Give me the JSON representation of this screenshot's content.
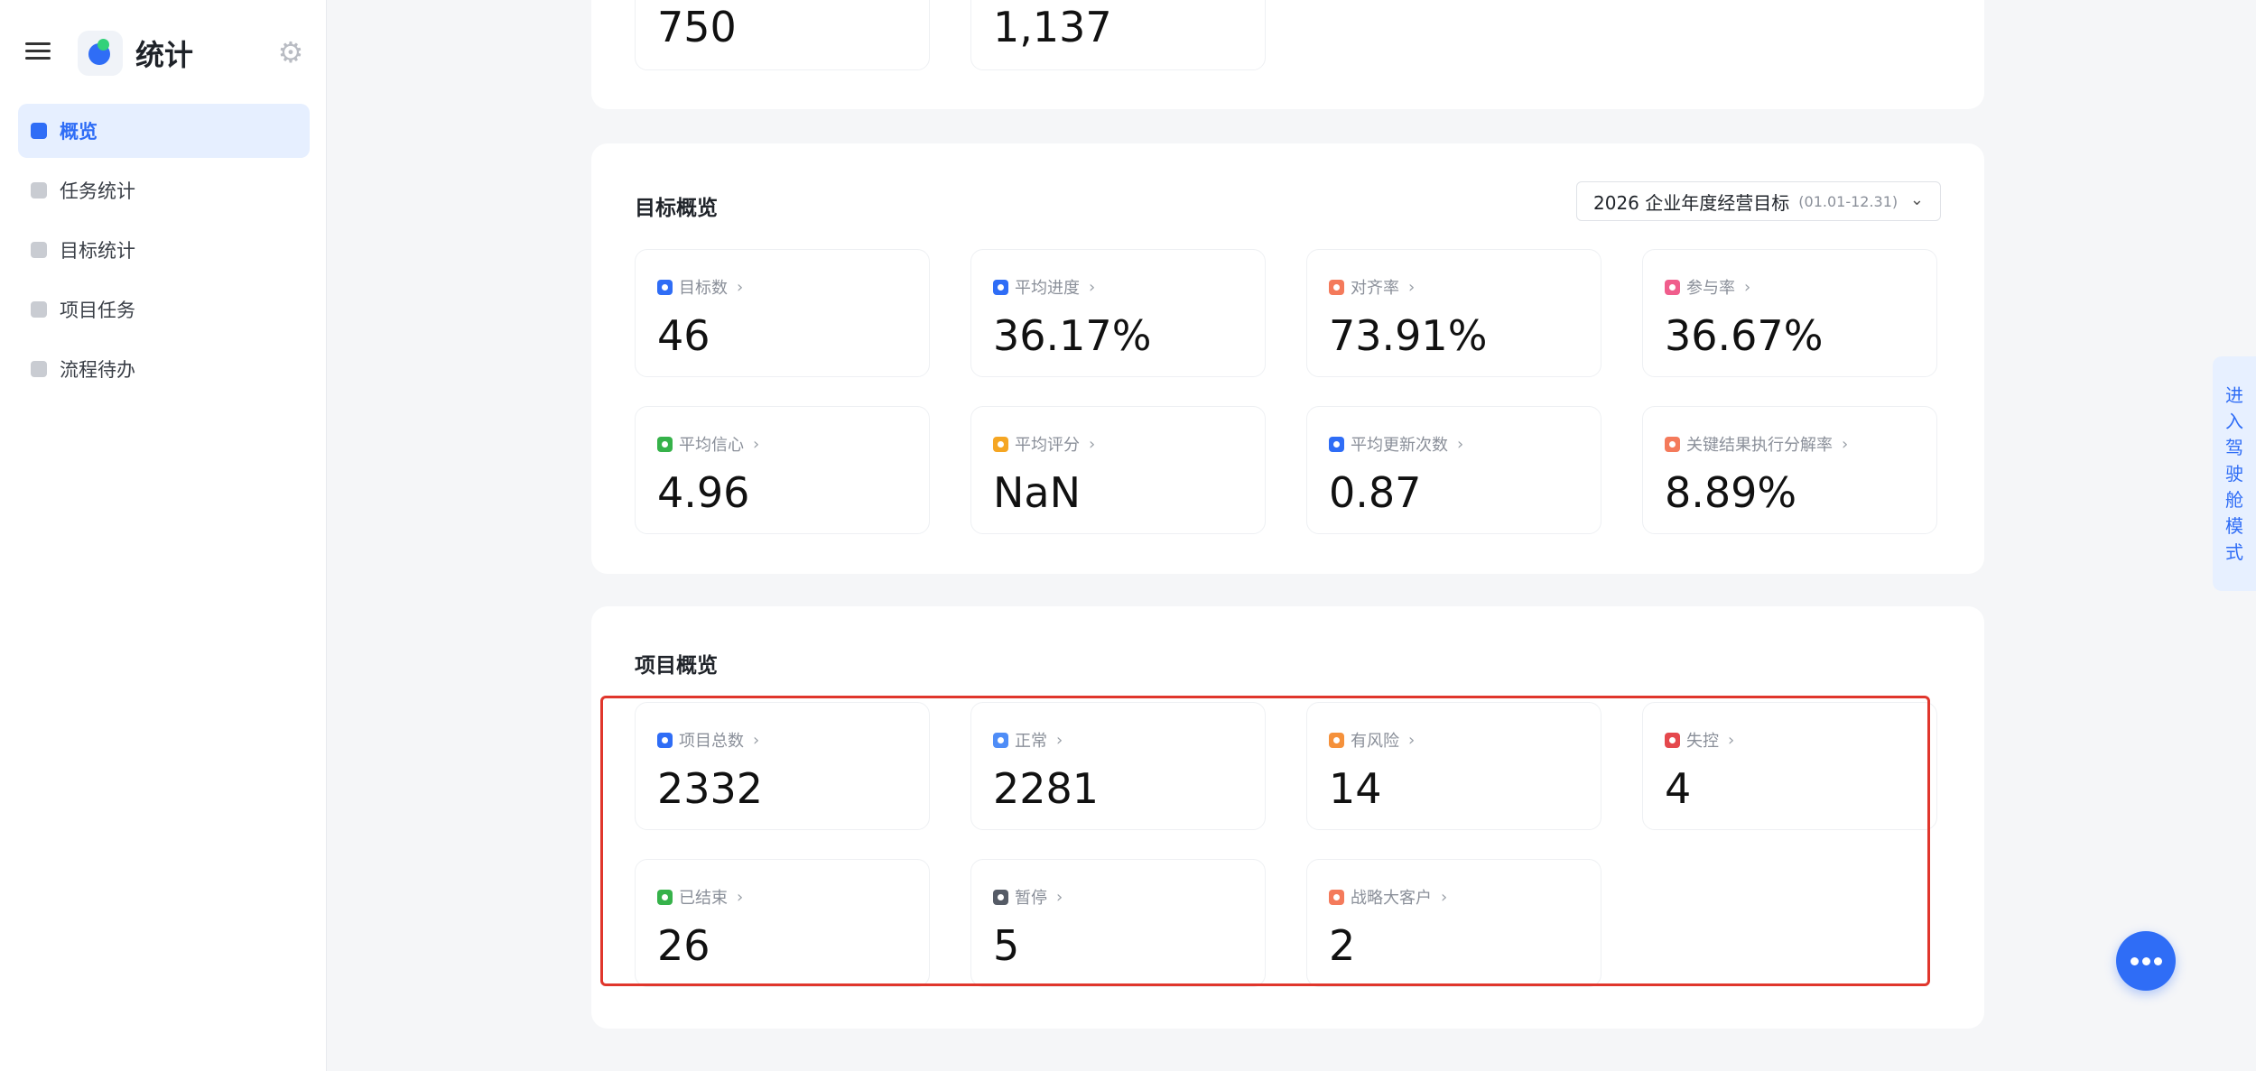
{
  "app": {
    "title": "统计"
  },
  "sidebar": {
    "items": [
      {
        "label": "概览",
        "active": true
      },
      {
        "label": "任务统计"
      },
      {
        "label": "目标统计"
      },
      {
        "label": "项目任务"
      },
      {
        "label": "流程待办"
      }
    ]
  },
  "top_section": {
    "values": [
      "750",
      "1,137"
    ]
  },
  "goal_overview": {
    "title": "目标概览",
    "dropdown": {
      "label": "2026 企业年度经营目标",
      "range": "(01.01-12.31)"
    },
    "stats": [
      {
        "label": "目标数",
        "value": "46",
        "color": "#2f6df6"
      },
      {
        "label": "平均进度",
        "value": "36.17%",
        "color": "#2f6df6"
      },
      {
        "label": "对齐率",
        "value": "73.91%",
        "color": "#f47a5b"
      },
      {
        "label": "参与率",
        "value": "36.67%",
        "color": "#f05d8c"
      },
      {
        "label": "平均信心",
        "value": "4.96",
        "color": "#36b24a"
      },
      {
        "label": "平均评分",
        "value": "NaN",
        "color": "#f5a623"
      },
      {
        "label": "平均更新次数",
        "value": "0.87",
        "color": "#2f6df6"
      },
      {
        "label": "关键结果执行分解率",
        "value": "8.89%",
        "color": "#f47a5b"
      }
    ]
  },
  "project_overview": {
    "title": "项目概览",
    "stats": [
      {
        "label": "项目总数",
        "value": "2332",
        "color": "#2f6df6"
      },
      {
        "label": "正常",
        "value": "2281",
        "color": "#4f8df7"
      },
      {
        "label": "有风险",
        "value": "14",
        "color": "#f5913b"
      },
      {
        "label": "失控",
        "value": "4",
        "color": "#e5484d"
      },
      {
        "label": "已结束",
        "value": "26",
        "color": "#36b24a"
      },
      {
        "label": "暂停",
        "value": "5",
        "color": "#555b66"
      },
      {
        "label": "战略大客户",
        "value": "2",
        "color": "#f47a5b"
      }
    ]
  },
  "cockpit_button": {
    "label": "进入驾驶舱模式"
  },
  "fab": {
    "icon": "more-icon"
  }
}
